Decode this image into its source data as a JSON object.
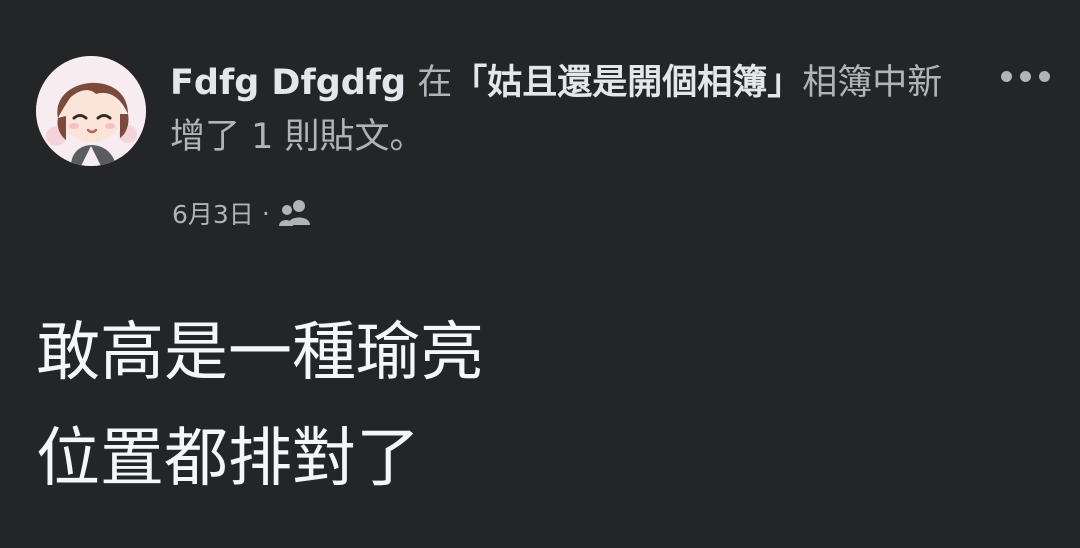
{
  "post": {
    "author": "Fdfg Dfgdfg",
    "action_prefix": "在",
    "album_name": "「姑且還是開個相簿」",
    "action_suffix": "相簿中新增了 1 則貼文。",
    "date": "6月3日",
    "separator": "·",
    "audience_icon": "friends-icon",
    "more_icon": "more-options-icon",
    "body_lines": [
      "敢高是一種瑜亮",
      "位置都排對了"
    ]
  },
  "colors": {
    "background": "#242526",
    "primary_text": "#e4e6eb",
    "secondary_text": "#b0b3b8"
  }
}
